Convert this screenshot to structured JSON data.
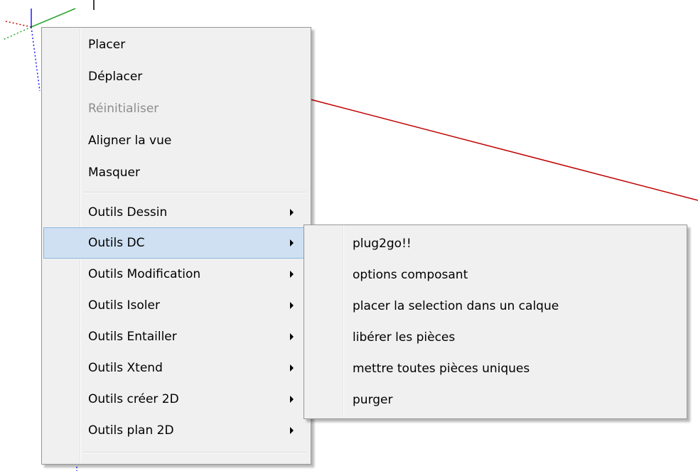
{
  "colors": {
    "menu_background": "#f0f0f0",
    "menu_border": "#979797",
    "highlight_background": "#cfe0f2",
    "highlight_border": "#8fb6dd",
    "disabled_text": "#8d8d8d",
    "red_axis": "#c00000",
    "green_axis": "#2ea52e",
    "blue_axis": "#1a1aff"
  },
  "context_menu": {
    "items": [
      {
        "label": "Placer",
        "enabled": true,
        "submenu": false
      },
      {
        "label": "Déplacer",
        "enabled": true,
        "submenu": false
      },
      {
        "label": "Réinitialiser",
        "enabled": false,
        "submenu": false
      },
      {
        "label": "Aligner la vue",
        "enabled": true,
        "submenu": false
      },
      {
        "label": "Masquer",
        "enabled": true,
        "submenu": false
      },
      {
        "label": "Outils Dessin",
        "enabled": true,
        "submenu": true
      },
      {
        "label": "Outils DC",
        "enabled": true,
        "submenu": true,
        "highlighted": true
      },
      {
        "label": "Outils Modification",
        "enabled": true,
        "submenu": true
      },
      {
        "label": "Outils Isoler",
        "enabled": true,
        "submenu": true
      },
      {
        "label": "Outils Entailler",
        "enabled": true,
        "submenu": true
      },
      {
        "label": "Outils Xtend",
        "enabled": true,
        "submenu": true
      },
      {
        "label": "Outils créer 2D",
        "enabled": true,
        "submenu": true
      },
      {
        "label": "Outils plan 2D",
        "enabled": true,
        "submenu": true
      }
    ]
  },
  "submenu": {
    "parent": "Outils DC",
    "items": [
      {
        "label": "plug2go!!"
      },
      {
        "label": "options composant"
      },
      {
        "label": "placer la selection dans un calque"
      },
      {
        "label": "libérer les pièces"
      },
      {
        "label": "mettre toutes pièces uniques"
      },
      {
        "label": "purger"
      }
    ]
  }
}
